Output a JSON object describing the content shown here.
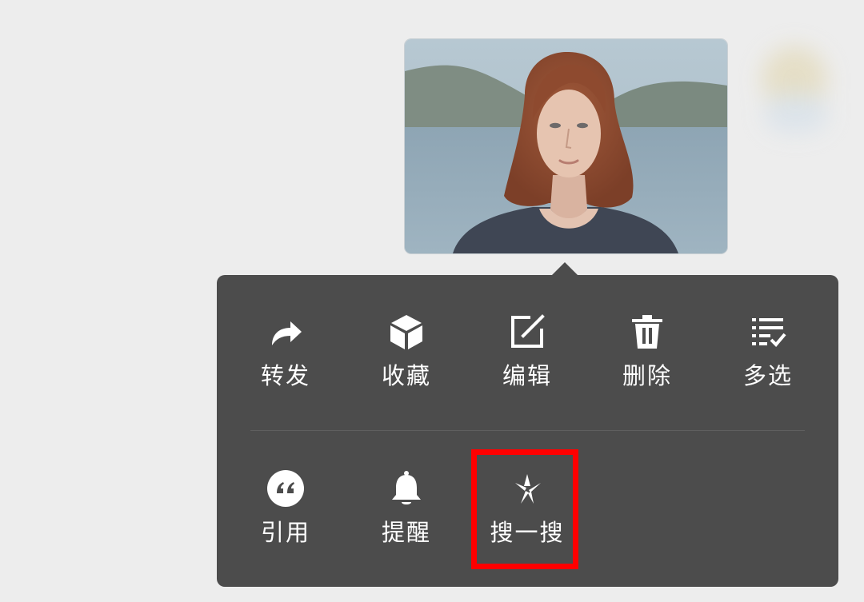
{
  "menu": {
    "row1": [
      {
        "label": "转发",
        "icon": "share-arrow-icon"
      },
      {
        "label": "收藏",
        "icon": "cube-favorite-icon"
      },
      {
        "label": "编辑",
        "icon": "edit-pencil-icon"
      },
      {
        "label": "删除",
        "icon": "trash-icon"
      },
      {
        "label": "多选",
        "icon": "multi-select-list-icon"
      }
    ],
    "row2": [
      {
        "label": "引用",
        "icon": "quote-icon"
      },
      {
        "label": "提醒",
        "icon": "bell-icon"
      },
      {
        "label": "搜一搜",
        "icon": "search-sparkle-icon"
      }
    ]
  },
  "colors": {
    "background": "#ededed",
    "menu": "#4c4c4c",
    "menu_text": "#ffffff",
    "highlight": "#ff0000"
  }
}
